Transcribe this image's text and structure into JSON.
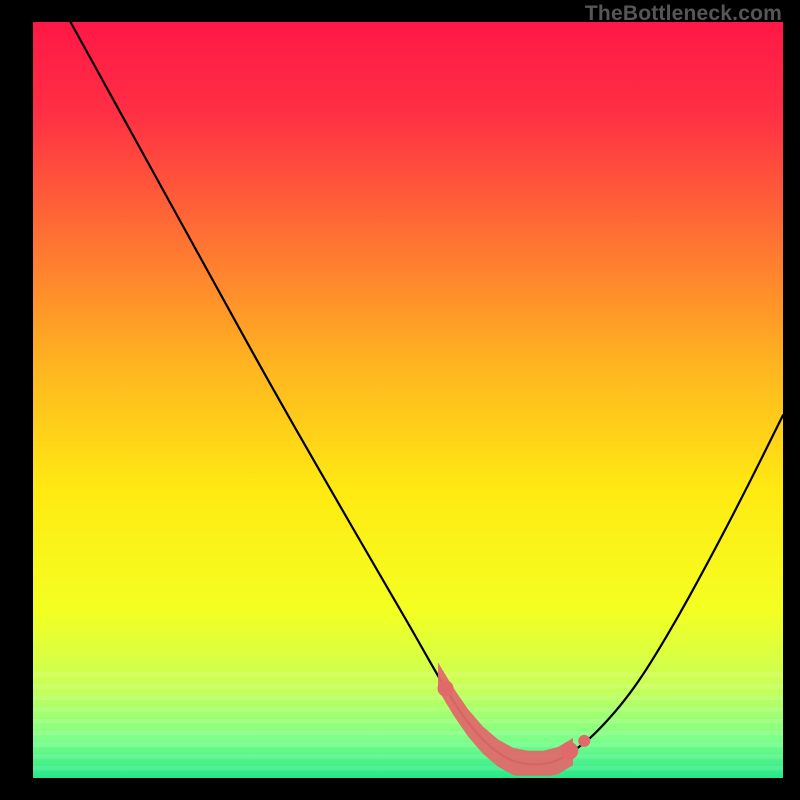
{
  "watermark": "TheBottleneck.com",
  "chart_data": {
    "type": "line",
    "title": "",
    "xlabel": "",
    "ylabel": "",
    "xlim": [
      0,
      100
    ],
    "ylim": [
      0,
      100
    ],
    "curve": {
      "x": [
        5,
        10,
        15,
        20,
        25,
        30,
        35,
        40,
        45,
        50,
        52,
        54,
        56,
        58,
        60,
        62,
        64,
        66,
        68,
        70,
        72,
        75,
        80,
        85,
        90,
        95,
        100
      ],
      "y": [
        100,
        91.0,
        82.0,
        73.0,
        64.0,
        55.0,
        46.2,
        37.6,
        29.0,
        20.5,
        17.0,
        13.5,
        10.2,
        7.3,
        5.0,
        3.3,
        2.2,
        1.8,
        1.8,
        2.3,
        3.5,
        5.8,
        11.5,
        19.5,
        28.5,
        38.0,
        48.0
      ]
    },
    "highlight_band": {
      "x_start": 54,
      "x_end": 72,
      "y_low": 1.5,
      "y_high": 5.5
    },
    "background_gradient": {
      "stops": [
        {
          "offset": 0.0,
          "color": "#ff1846"
        },
        {
          "offset": 0.12,
          "color": "#ff2f44"
        },
        {
          "offset": 0.28,
          "color": "#ff6f34"
        },
        {
          "offset": 0.45,
          "color": "#ffb321"
        },
        {
          "offset": 0.62,
          "color": "#ffea12"
        },
        {
          "offset": 0.78,
          "color": "#f4ff22"
        },
        {
          "offset": 0.88,
          "color": "#c8ff58"
        },
        {
          "offset": 0.95,
          "color": "#7bff89"
        },
        {
          "offset": 1.0,
          "color": "#25e88a"
        }
      ]
    },
    "stripes": {
      "y_start": 86,
      "count": 9,
      "color_opacity": 0.11
    }
  }
}
